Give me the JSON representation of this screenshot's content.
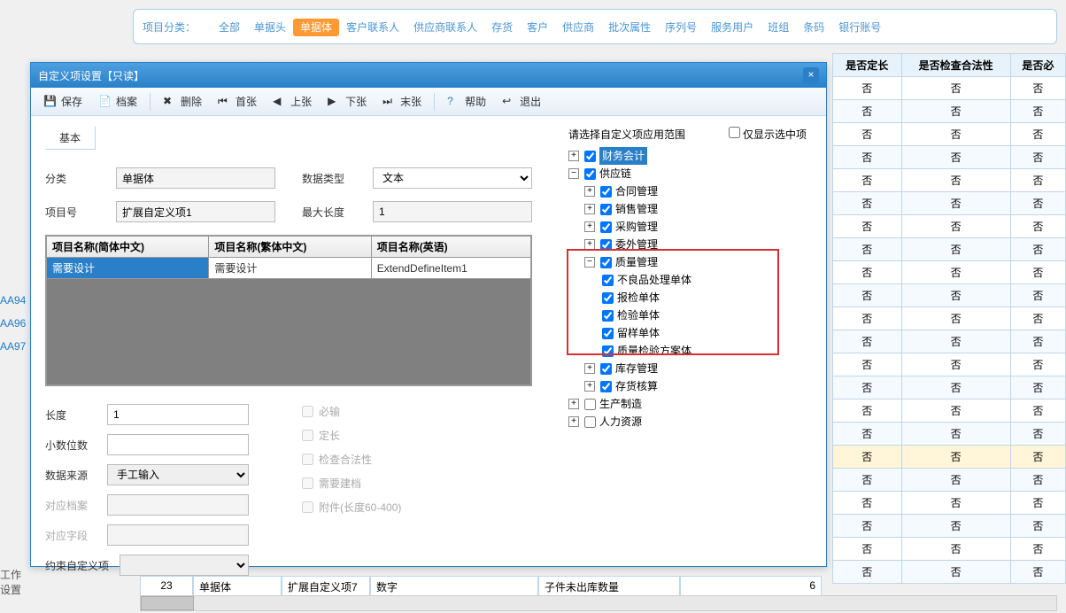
{
  "filterBar": {
    "label": "项目分类：",
    "items": [
      "全部",
      "单据头",
      "单据体",
      "客户联系人",
      "供应商联系人",
      "存货",
      "客户",
      "供应商",
      "批次属性",
      "序列号",
      "服务用户",
      "班组",
      "条码",
      "银行账号"
    ],
    "activeIndex": 2
  },
  "bgTable": {
    "headers": [
      "是否定长",
      "是否检查合法性",
      "是否必"
    ],
    "rows": [
      [
        "否",
        "否",
        "否"
      ],
      [
        "否",
        "否",
        "否"
      ],
      [
        "否",
        "否",
        "否"
      ],
      [
        "否",
        "否",
        "否"
      ],
      [
        "否",
        "否",
        "否"
      ],
      [
        "否",
        "否",
        "否"
      ],
      [
        "否",
        "否",
        "否"
      ],
      [
        "否",
        "否",
        "否"
      ],
      [
        "否",
        "否",
        "否"
      ],
      [
        "否",
        "否",
        "否"
      ],
      [
        "否",
        "否",
        "否"
      ],
      [
        "否",
        "否",
        "否"
      ],
      [
        "否",
        "否",
        "否"
      ],
      [
        "否",
        "否",
        "否"
      ],
      [
        "否",
        "否",
        "否"
      ],
      [
        "否",
        "否",
        "否"
      ],
      [
        "否",
        "否",
        "否"
      ],
      [
        "否",
        "否",
        "否"
      ],
      [
        "否",
        "否",
        "否"
      ],
      [
        "否",
        "否",
        "否"
      ],
      [
        "否",
        "否",
        "否"
      ],
      [
        "否",
        "否",
        "否"
      ]
    ],
    "hlIndex": 16
  },
  "sidebar": {
    "items": [
      "AA94",
      "AA96",
      "AA97"
    ],
    "bottom1": "工作",
    "bottom2": "设置"
  },
  "bottomRow": {
    "c1": "23",
    "c2": "单据体",
    "c3": "扩展自定义项7",
    "c4": "数字",
    "c5": "",
    "c6": "子件未出库数量",
    "c7": "6"
  },
  "dialog": {
    "title": "自定义项设置【只读】",
    "toolbar": {
      "save": "保存",
      "archive": "档案",
      "delete": "删除",
      "first": "首张",
      "prev": "上张",
      "next": "下张",
      "last": "末张",
      "help": "帮助",
      "exit": "退出"
    },
    "tab": "基本",
    "form": {
      "category_label": "分类",
      "category_value": "单据体",
      "datatype_label": "数据类型",
      "datatype_value": "文本",
      "itemno_label": "项目号",
      "itemno_value": "扩展自定义项1",
      "maxlen_label": "最大长度",
      "maxlen_value": "1"
    },
    "table": {
      "h1": "项目名称(简体中文)",
      "h2": "项目名称(繁体中文)",
      "h3": "项目名称(英语)",
      "r1c1": "需要设计",
      "r1c2": "需要设计",
      "r1c3": "ExtendDefineItem1"
    },
    "lower": {
      "length_label": "长度",
      "length_value": "1",
      "decimal_label": "小数位数",
      "decimal_value": "",
      "source_label": "数据来源",
      "source_value": "手工输入",
      "archive_label": "对应档案",
      "field_label": "对应字段",
      "constraint_label": "约束自定义项",
      "cb_required": "必输",
      "cb_fixed": "定长",
      "cb_legal": "检查合法性",
      "cb_needarch": "需要建档",
      "cb_attach": "附件(长度60-400)"
    },
    "tree": {
      "header": "请选择自定义项应用范围",
      "showonly": "仅显示选中项",
      "n_finance": "财务会计",
      "n_supply": "供应链",
      "n_contract": "合同管理",
      "n_sales": "销售管理",
      "n_purchase": "采购管理",
      "n_outsrc": "委外管理",
      "n_quality": "质量管理",
      "n_q1": "不良品处理单体",
      "n_q2": "报检单体",
      "n_q3": "检验单体",
      "n_q4": "留样单体",
      "n_q5": "质量检验方案体",
      "n_stock": "库存管理",
      "n_inv": "存货核算",
      "n_prod": "生产制造",
      "n_hr": "人力资源"
    }
  }
}
